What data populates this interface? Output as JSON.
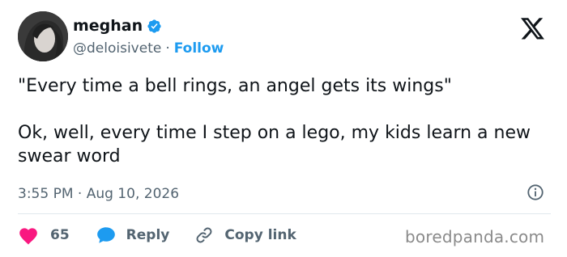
{
  "author": {
    "display_name": "meghan",
    "handle": "@deloisivete",
    "separator": "·",
    "follow_label": "Follow",
    "verified_icon": "verified-badge-icon",
    "avatar_icon": "avatar"
  },
  "platform": {
    "logo_icon": "x-logo-icon"
  },
  "tweet": {
    "line1": "\"Every time a bell rings, an angel gets its wings\"",
    "line2": "Ok, well, every time I step on a lego, my kids learn a new swear word",
    "timestamp": "3:55 PM · Aug 10, 2026"
  },
  "actions": {
    "like_count": "65",
    "reply_label": "Reply",
    "copy_label": "Copy link"
  },
  "watermark": "boredpanda.com",
  "colors": {
    "accent": "#1d9bf0",
    "heart": "#f91880",
    "text": "#0f1419",
    "muted": "#536471"
  }
}
